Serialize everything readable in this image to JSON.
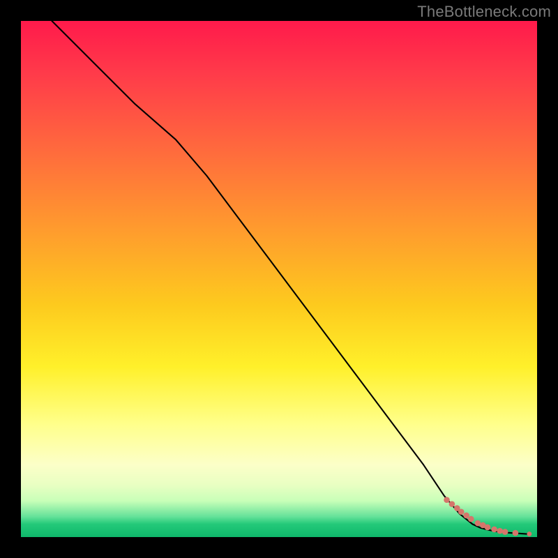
{
  "watermark": "TheBottleneck.com",
  "chart_data": {
    "type": "line",
    "title": "",
    "xlabel": "",
    "ylabel": "",
    "xlim": [
      0,
      100
    ],
    "ylim": [
      0,
      100
    ],
    "curve": {
      "name": "bottleneck-curve",
      "x": [
        6,
        14,
        22,
        30,
        36,
        42,
        48,
        54,
        60,
        66,
        72,
        78,
        82,
        85,
        87.5,
        89,
        90.5,
        92,
        93.5,
        95,
        96.5,
        98
      ],
      "y": [
        100,
        92,
        84,
        77,
        70,
        62,
        54,
        46,
        38,
        30,
        22,
        14,
        8,
        4.5,
        2.5,
        1.8,
        1.4,
        1.1,
        0.9,
        0.8,
        0.7,
        0.6
      ]
    },
    "points": {
      "name": "tail-dots",
      "color": "#d5766b",
      "x": [
        82.5,
        83.5,
        84.5,
        85.3,
        86.3,
        87.2,
        88.5,
        89.5,
        90.4,
        91.7,
        92.8,
        93.8,
        95.8,
        98.5
      ],
      "y": [
        7.2,
        6.4,
        5.6,
        4.9,
        4.2,
        3.5,
        2.7,
        2.3,
        1.9,
        1.5,
        1.2,
        1.0,
        0.8,
        0.6
      ]
    }
  }
}
